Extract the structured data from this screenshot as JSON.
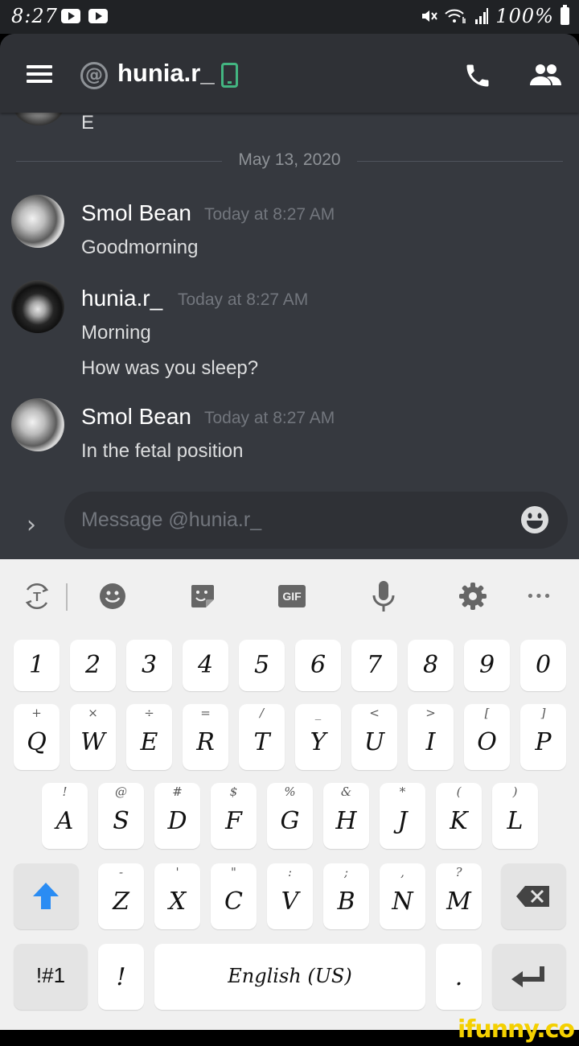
{
  "status_bar": {
    "time": "8:27",
    "battery": "100%"
  },
  "header": {
    "title": "hunia.r_",
    "icons": [
      "menu-icon",
      "at-icon",
      "mobile-status-icon",
      "call-icon",
      "members-icon"
    ]
  },
  "messages": {
    "partial_text": "E",
    "date_divider": "May 13, 2020",
    "groups": [
      {
        "author": "Smol Bean",
        "timestamp": "Today at 8:27 AM",
        "lines": [
          "Goodmorning"
        ]
      },
      {
        "author": "hunia.r_",
        "timestamp": "Today at 8:27 AM",
        "lines": [
          "Morning",
          "How was you sleep?"
        ]
      },
      {
        "author": "Smol Bean",
        "timestamp": "Today at 8:27 AM",
        "lines": [
          "In the fetal position"
        ]
      }
    ]
  },
  "composer": {
    "placeholder": "Message @hunia.r_"
  },
  "keyboard": {
    "toolbar": {
      "translate_glyph": "T",
      "gif_label": "GIF",
      "more": "•••"
    },
    "rows": [
      [
        "1",
        "2",
        "3",
        "4",
        "5",
        "6",
        "7",
        "8",
        "9",
        "0"
      ],
      [
        "Q",
        "W",
        "E",
        "R",
        "T",
        "Y",
        "U",
        "I",
        "O",
        "P"
      ],
      [
        "A",
        "S",
        "D",
        "F",
        "G",
        "H",
        "J",
        "K",
        "L"
      ],
      [
        "Z",
        "X",
        "C",
        "V",
        "B",
        "N",
        "M"
      ]
    ],
    "hints": {
      "row2": [
        "+",
        "×",
        "÷",
        "=",
        "/",
        "_",
        "<",
        ">",
        "[",
        "]"
      ],
      "row3": [
        "!",
        "@",
        "#",
        "$",
        "%",
        "&",
        "*",
        "(",
        ")"
      ],
      "row4": [
        "-",
        "'",
        "\"",
        ":",
        ";",
        ",",
        "?"
      ]
    },
    "symbols_key": "!#1",
    "exclaim_key": "!",
    "space_label": "English (US)",
    "period_key": "."
  },
  "watermark": "ifunny.co",
  "colors": {
    "app_bg": "#36393f",
    "header_bg": "#2f3136",
    "online_green": "#43b581",
    "shift_blue": "#2a8cf3",
    "keyboard_bg": "#f0f0f0"
  }
}
